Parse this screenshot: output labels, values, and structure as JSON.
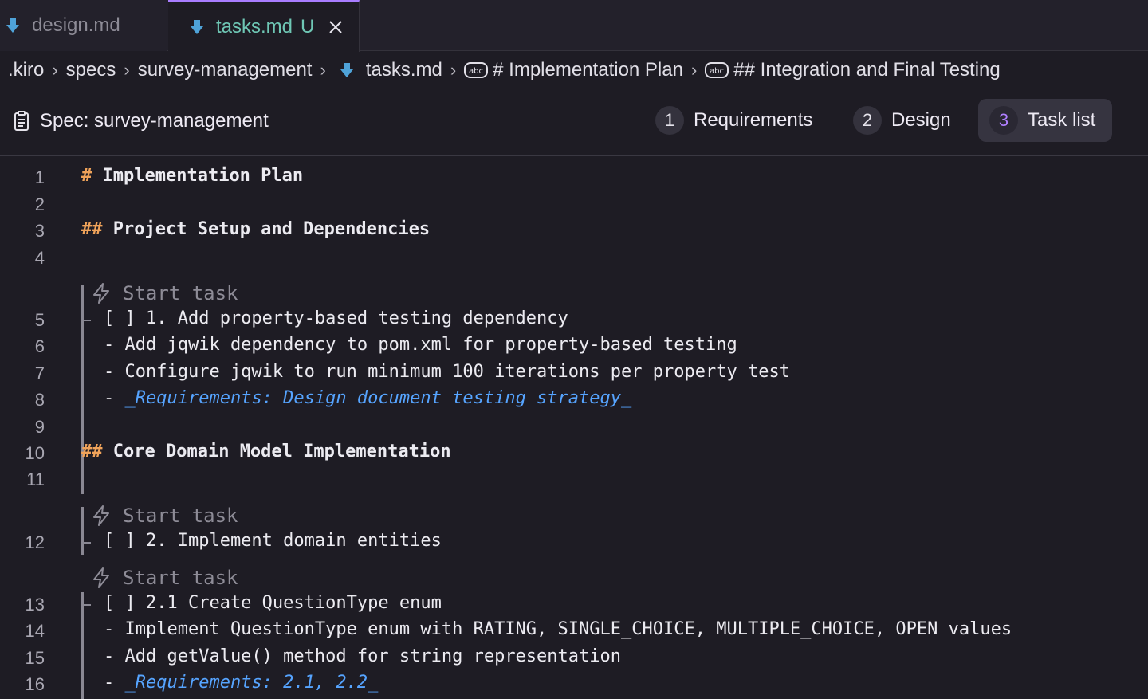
{
  "tabs": [
    {
      "label": "design.md",
      "active": false
    },
    {
      "label": "tasks.md",
      "active": true,
      "status": "U"
    }
  ],
  "breadcrumb": [
    ".kiro",
    "specs",
    "survey-management",
    "tasks.md",
    "# Implementation Plan",
    "## Integration and Final Testing"
  ],
  "spec": {
    "title": "Spec: survey-management",
    "steps": [
      {
        "num": "1",
        "label": "Requirements"
      },
      {
        "num": "2",
        "label": "Design"
      },
      {
        "num": "3",
        "label": "Task list",
        "active": true
      }
    ]
  },
  "codelens_label": "Start task",
  "lines": {
    "1": "Implementation Plan",
    "3": "Project Setup and Dependencies",
    "5": "[ ] 1. Add property-based testing dependency",
    "6": "- Add jqwik dependency to pom.xml for property-based testing",
    "7": "- Configure jqwik to run minimum 100 iterations per property test",
    "8": "_Requirements: Design document testing strategy_",
    "10": "Core Domain Model Implementation",
    "12": "[ ] 2. Implement domain entities",
    "13": "[ ] 2.1 Create QuestionType enum",
    "14": "- Implement QuestionType enum with RATING, SINGLE_CHOICE, MULTIPLE_CHOICE, OPEN values",
    "15": "- Add getValue() method for string representation",
    "16": "_Requirements: 2.1, 2.2_"
  },
  "line_numbers": [
    "1",
    "2",
    "3",
    "4",
    "5",
    "6",
    "7",
    "8",
    "9",
    "10",
    "11",
    "12",
    "13",
    "14",
    "15",
    "16"
  ],
  "colors": {
    "accent": "#a97dff",
    "heading_marker": "#f0a35a",
    "link": "#56a4ff",
    "modified": "#6fc7b5"
  }
}
